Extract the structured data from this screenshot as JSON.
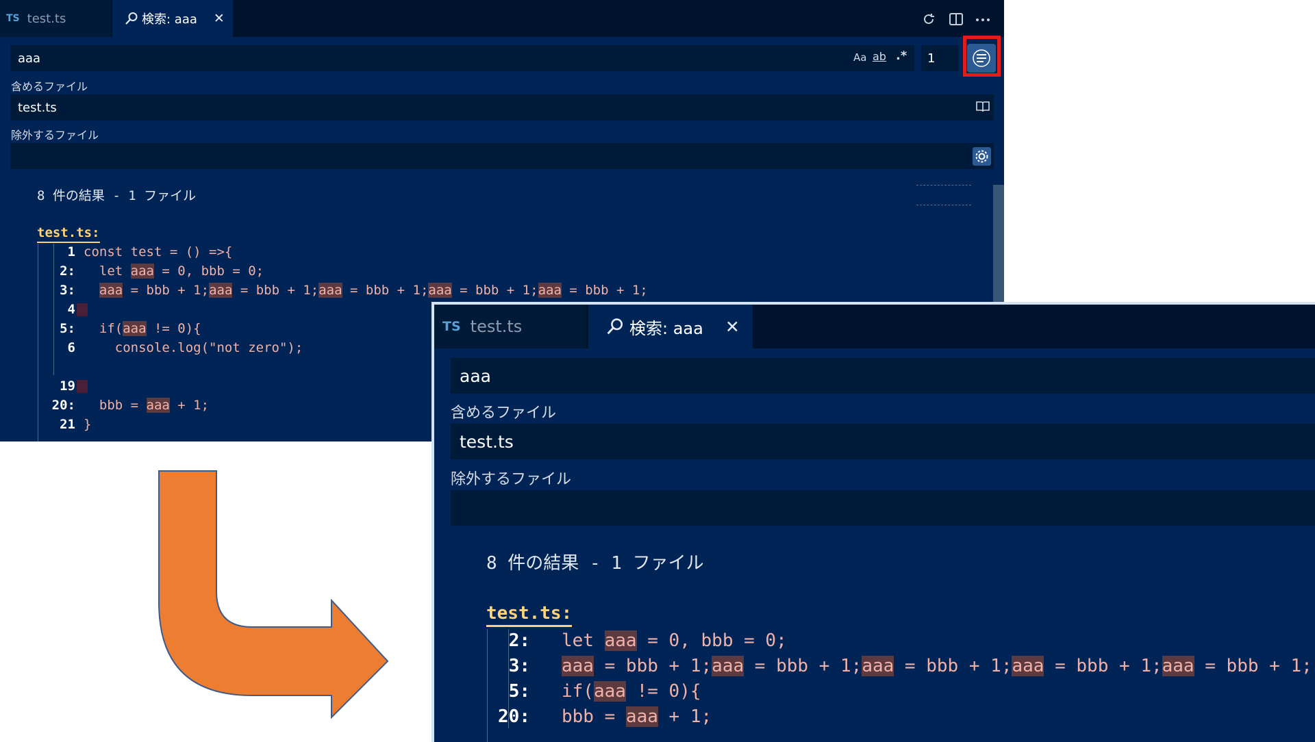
{
  "top_panel": {
    "tabs": [
      {
        "badge": "TS",
        "label": "test.ts",
        "icon": "typescript-icon"
      },
      {
        "label": "検索: aaa",
        "icon": "search-icon",
        "close": "✕"
      }
    ],
    "toolbar_icons": [
      "refresh-icon",
      "split-editor-icon",
      "more-icon"
    ],
    "search_value": "aaa",
    "search_options": {
      "match_case": "Aa",
      "whole_word": "ab",
      "regex": ".*"
    },
    "context_lines": "1",
    "include_label": "含めるファイル",
    "include_value": "test.ts",
    "exclude_label": "除外するファイル",
    "exclude_value": "",
    "summary": "8 件の結果 - 1 ファイル",
    "file": "test.ts:",
    "lines": [
      {
        "n": "1",
        "segs": [
          [
            "const test = () =>{",
            "t"
          ]
        ]
      },
      {
        "n": "2:",
        "segs": [
          [
            "  let ",
            "t"
          ],
          [
            "aaa",
            "m"
          ],
          [
            " = 0, bbb = 0;",
            "t"
          ]
        ]
      },
      {
        "n": "3:",
        "segs": [
          [
            "  ",
            "t"
          ],
          [
            "aaa",
            "m"
          ],
          [
            " = bbb + 1;",
            "t"
          ],
          [
            "aaa",
            "m"
          ],
          [
            " = bbb + 1;",
            "t"
          ],
          [
            "aaa",
            "m"
          ],
          [
            " = bbb + 1;",
            "t"
          ],
          [
            "aaa",
            "m"
          ],
          [
            " = bbb + 1;",
            "t"
          ],
          [
            "aaa",
            "m"
          ],
          [
            " = bbb + 1;",
            "t"
          ]
        ]
      },
      {
        "n": "4",
        "segs": []
      },
      {
        "n": "5:",
        "segs": [
          [
            "  if(",
            "t"
          ],
          [
            "aaa",
            "m"
          ],
          [
            " != 0){",
            "t"
          ]
        ]
      },
      {
        "n": "6",
        "segs": [
          [
            "    console.log(\"not zero\");",
            "t"
          ]
        ]
      },
      {
        "n": "",
        "segs": []
      },
      {
        "n": "19",
        "segs": []
      },
      {
        "n": "20:",
        "segs": [
          [
            "  bbb = ",
            "t"
          ],
          [
            "aaa",
            "m"
          ],
          [
            " + 1;",
            "t"
          ]
        ]
      },
      {
        "n": "21",
        "segs": [
          [
            "}",
            "t"
          ]
        ]
      }
    ],
    "highlight_color": "#e31b1b"
  },
  "bottom_panel": {
    "tabs": [
      {
        "badge": "TS",
        "label": "test.ts",
        "icon": "typescript-icon"
      },
      {
        "label": "検索: aaa",
        "icon": "search-icon",
        "close": "✕"
      }
    ],
    "search_value": "aaa",
    "include_label": "含めるファイル",
    "include_value": "test.ts",
    "exclude_label": "除外するファイル",
    "exclude_value": "",
    "summary": "8 件の結果 - 1 ファイル",
    "file": "test.ts:",
    "lines": [
      {
        "n": "2:",
        "segs": [
          [
            "let ",
            "t"
          ],
          [
            "aaa",
            "m"
          ],
          [
            " = 0, bbb = 0;",
            "t"
          ]
        ]
      },
      {
        "n": "3:",
        "segs": [
          [
            "aaa",
            "m"
          ],
          [
            " = bbb + 1;",
            "t"
          ],
          [
            "aaa",
            "m"
          ],
          [
            " = bbb + 1;",
            "t"
          ],
          [
            "aaa",
            "m"
          ],
          [
            " = bbb + 1;",
            "t"
          ],
          [
            "aaa",
            "m"
          ],
          [
            " = bbb + 1;",
            "t"
          ],
          [
            "aaa",
            "m"
          ],
          [
            " = bbb + 1;",
            "t"
          ]
        ]
      },
      {
        "n": "5:",
        "segs": [
          [
            "if(",
            "t"
          ],
          [
            "aaa",
            "m"
          ],
          [
            " != 0){",
            "t"
          ]
        ]
      },
      {
        "n": "20:",
        "segs": [
          [
            "bbb = ",
            "t"
          ],
          [
            "aaa",
            "m"
          ],
          [
            " + 1;",
            "t"
          ]
        ]
      }
    ]
  },
  "arrow": {
    "color": "#ed7d31",
    "direction": "down-then-right"
  }
}
